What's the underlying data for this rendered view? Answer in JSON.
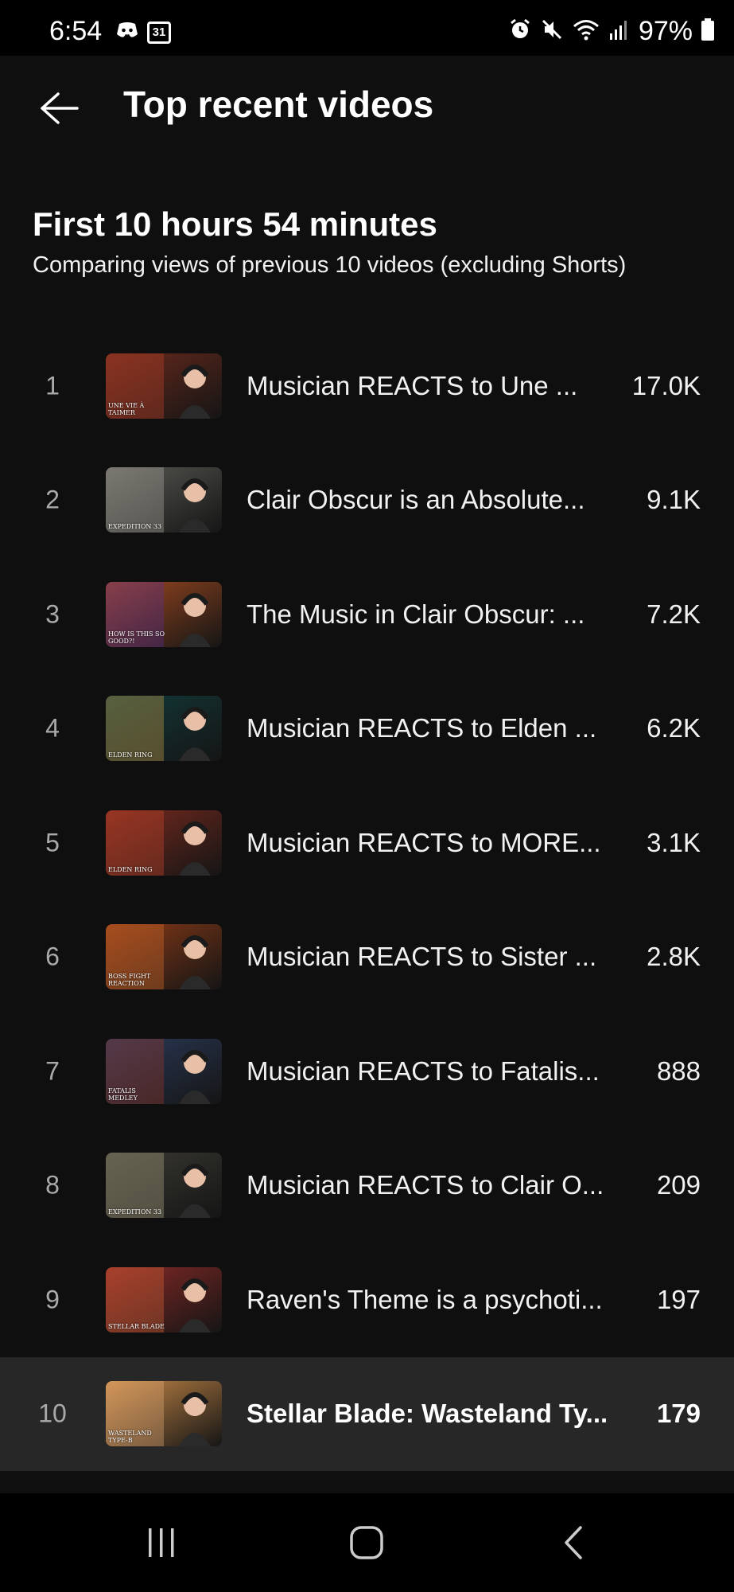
{
  "status_bar": {
    "time": "6:54",
    "calendar_day": "31",
    "battery": "97%"
  },
  "header": {
    "title": "Top recent videos"
  },
  "section": {
    "title": "First 10 hours 54 minutes",
    "subtitle": "Comparing views of previous 10 videos (excluding Shorts)"
  },
  "videos": [
    {
      "rank": "1",
      "title": "Musician REACTS to Une ...",
      "views": "17.0K",
      "thumb_text": "UNE VIE À TAIMER",
      "thumb_bg": "#6b2a1c",
      "thumb_accent": "#c5462b"
    },
    {
      "rank": "2",
      "title": "Clair Obscur is an Absolute...",
      "views": "9.1K",
      "thumb_text": "EXPEDITION 33",
      "thumb_bg": "#5a5a55",
      "thumb_accent": "#b8b3a5"
    },
    {
      "rank": "3",
      "title": "The Music in Clair Obscur: ...",
      "views": "7.2K",
      "thumb_text": "HOW IS THIS SO GOOD?!",
      "thumb_bg": "#a0491f",
      "thumb_accent": "#5c2f9e"
    },
    {
      "rank": "4",
      "title": "Musician REACTS to Elden ...",
      "views": "6.2K",
      "thumb_text": "ELDEN RING",
      "thumb_bg": "#123a3a",
      "thumb_accent": "#d6a84a"
    },
    {
      "rank": "5",
      "title": "Musician REACTS to MORE...",
      "views": "3.1K",
      "thumb_text": "ELDEN RING",
      "thumb_bg": "#7a2a1e",
      "thumb_accent": "#d04a2f"
    },
    {
      "rank": "6",
      "title": "Musician REACTS to Sister ...",
      "views": "2.8K",
      "thumb_text": "BOSS FIGHT REACTION",
      "thumb_bg": "#8b3a16",
      "thumb_accent": "#e0742d"
    },
    {
      "rank": "7",
      "title": "Musician REACTS to Fatalis...",
      "views": "888",
      "thumb_text": "FATALIS MEDLEY",
      "thumb_bg": "#2b3a5a",
      "thumb_accent": "#a23a2a"
    },
    {
      "rank": "8",
      "title": "Musician REACTS to Clair O...",
      "views": "209",
      "thumb_text": "EXPEDITION 33",
      "thumb_bg": "#3c3b33",
      "thumb_accent": "#b8ae8c"
    },
    {
      "rank": "9",
      "title": "Raven's Theme is a psychoti...",
      "views": "197",
      "thumb_text": "STELLAR BLADE",
      "thumb_bg": "#8a2a26",
      "thumb_accent": "#e16a3a"
    },
    {
      "rank": "10",
      "title": "Stellar Blade: Wasteland Ty...",
      "views": "179",
      "thumb_text": "WASTELAND TYPE-B",
      "thumb_bg": "#c98a48",
      "thumb_accent": "#e8b07a"
    }
  ],
  "highlighted_index": 9
}
